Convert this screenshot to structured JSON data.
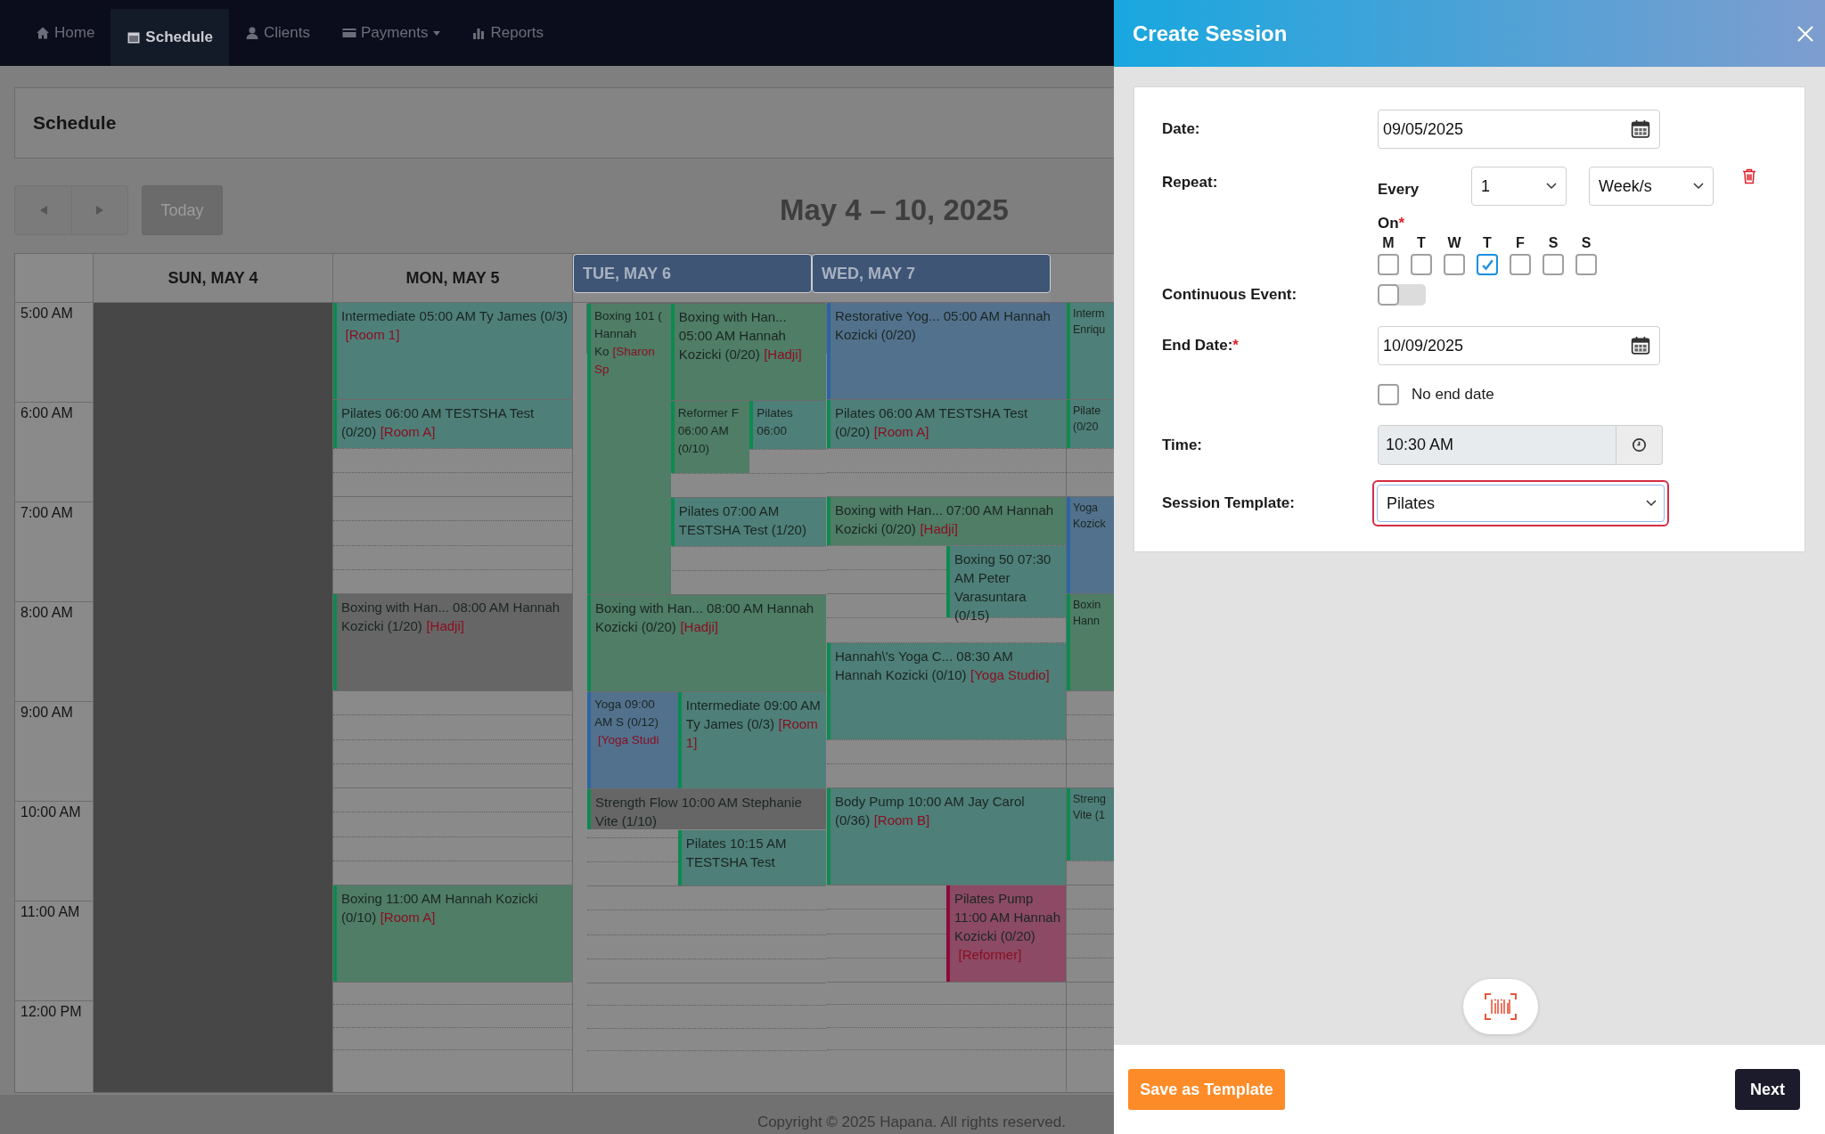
{
  "nav": {
    "items": [
      {
        "label": "Home",
        "selected": false,
        "dropdown": false
      },
      {
        "label": "Schedule",
        "selected": true,
        "dropdown": false
      },
      {
        "label": "Clients",
        "selected": false,
        "dropdown": false
      },
      {
        "label": "Payments",
        "selected": false,
        "dropdown": true
      },
      {
        "label": "Reports",
        "selected": false,
        "dropdown": false
      }
    ]
  },
  "page": {
    "title": "Schedule",
    "today_button": "Today",
    "range_title": "May 4 – 10, 2025"
  },
  "calendar": {
    "times": [
      "5:00 AM",
      "6:00 AM",
      "7:00 AM",
      "8:00 AM",
      "9:00 AM",
      "10:00 AM",
      "11:00 AM",
      "12:00 PM"
    ],
    "days": [
      {
        "label": "SUN, MAY 4",
        "selected": false,
        "today": false,
        "closed": true
      },
      {
        "label": "MON, MAY 5",
        "selected": false,
        "today": false,
        "closed": false,
        "events": [
          {
            "text": "Intermediate 05:00 AM Ty James (0/3)",
            "room": "[Room 1]",
            "color": "#4e7f78"
          },
          {
            "text": "Pilates 06:00 AM TESTSHA Test (0/20)",
            "room": "[Room A]",
            "color": "#4e7f78"
          },
          {
            "text": "Boxing with Han... 08:00 AM Hannah Kozicki (1/20)",
            "room": "[Hadji]",
            "color": "#666666"
          },
          {
            "text": "Boxing 11:00 AM Hannah Kozicki (0/10)",
            "room": "[Room A]",
            "color": "#4f7d66"
          }
        ]
      },
      {
        "label": "TUE, MAY 6",
        "selected": true,
        "today": true,
        "closed": false,
        "events": [
          {
            "text": "Boxing 101 ( Hannah Ko",
            "room": "[Sharon Sp",
            "color": "#4f7d66"
          },
          {
            "text": "Boxing with Han... 05:00 AM Hannah Kozicki (0/20)",
            "room": "[Hadji]",
            "color": "#4f7d66"
          },
          {
            "text": "Reformer F 06:00 AM (0/10)",
            "color": "#4f7d66"
          },
          {
            "text": "Pilates 06:00",
            "color": "#4e7f78"
          },
          {
            "text": "Pilates 07:00 AM TESTSHA Test (1/20)",
            "color": "#4e7f78"
          },
          {
            "text": "Boxing with Han... 08:00 AM Hannah Kozicki (0/20)",
            "room": "[Hadji]",
            "color": "#4f7d66"
          },
          {
            "text": "Yoga 09:00 AM S (0/12)",
            "room": "[Yoga Studi",
            "color": "#52718d"
          },
          {
            "text": "Intermediate 09:00 AM Ty James (0/3)",
            "room": "[Room 1]",
            "color": "#4e7f78"
          },
          {
            "text": "Strength Flow 10:00 AM Stephanie Vite (1/10)",
            "color": "#666666"
          },
          {
            "text": "Pilates 10:15 AM TESTSHA Test",
            "color": "#4e7f78"
          }
        ]
      },
      {
        "label": "WED, MAY 7",
        "selected": true,
        "today": false,
        "closed": false,
        "events": [
          {
            "text": "Restorative Yog... 05:00 AM Hannah Kozicki (0/20)",
            "color": "#52718d"
          },
          {
            "text": "Pilates 06:00 AM TESTSHA Test (0/20)",
            "room": "[Room A]",
            "color": "#4e7f78"
          },
          {
            "text": "Boxing with Han... 07:00 AM Hannah Kozicki (0/20)",
            "room": "[Hadji]",
            "color": "#4f7d66"
          },
          {
            "text": "Boxing 50 07:30 AM Peter Varasuntara (0/15)",
            "color": "#4e7f78"
          },
          {
            "text": "Hannah\\'s Yoga C... 08:30 AM Hannah Kozicki (0/10)",
            "room": "[Yoga Studio]",
            "color": "#4e7f78"
          },
          {
            "text": "Body Pump 10:00 AM Jay Carol (0/36)",
            "room": "[Room B]",
            "color": "#4e7f78"
          },
          {
            "text": "Pilates Pump 11:00 AM Hannah Kozicki (0/20)",
            "room": "[Reformer]",
            "color": "#8c4a64"
          }
        ]
      },
      {
        "selected": false,
        "today": false,
        "closed": false,
        "events": [
          {
            "text": "Interm Enriqu",
            "color": "#4e7f78"
          },
          {
            "text": "Pilate (0/20",
            "color": "#4e7f78"
          },
          {
            "text": "Yoga Kozick",
            "color": "#52718d"
          },
          {
            "text": "Boxin Hann",
            "color": "#4f7d66"
          },
          {
            "text": "Streng Vite (1",
            "color": "#4e7f78"
          }
        ]
      }
    ]
  },
  "footer": {
    "copyright": "Copyright © 2025 Hapana. All rights reserved."
  },
  "dialog": {
    "title": "Create Session",
    "date": {
      "label": "Date:",
      "value": "09/05/2025"
    },
    "repeat": {
      "label": "Repeat:",
      "every_label": "Every",
      "interval": "1",
      "unit": "Week/s",
      "on_label": "On",
      "required_mark": "*",
      "days": [
        {
          "label": "M",
          "checked": false
        },
        {
          "label": "T",
          "checked": false
        },
        {
          "label": "W",
          "checked": false
        },
        {
          "label": "T",
          "checked": true
        },
        {
          "label": "F",
          "checked": false
        },
        {
          "label": "S",
          "checked": false
        },
        {
          "label": "S",
          "checked": false
        }
      ]
    },
    "continuous": {
      "label": "Continuous Event:",
      "on": false
    },
    "end_date": {
      "label": "End Date:",
      "required_mark": "*",
      "value": "10/09/2025"
    },
    "no_end_date": {
      "label": "No end date",
      "checked": false
    },
    "time": {
      "label": "Time:",
      "value": "10:30 AM",
      "disabled": true
    },
    "session_template": {
      "label": "Session Template:",
      "value": "Pilates",
      "invalid": true
    },
    "buttons": {
      "save_template": "Save as Template",
      "next": "Next"
    }
  }
}
